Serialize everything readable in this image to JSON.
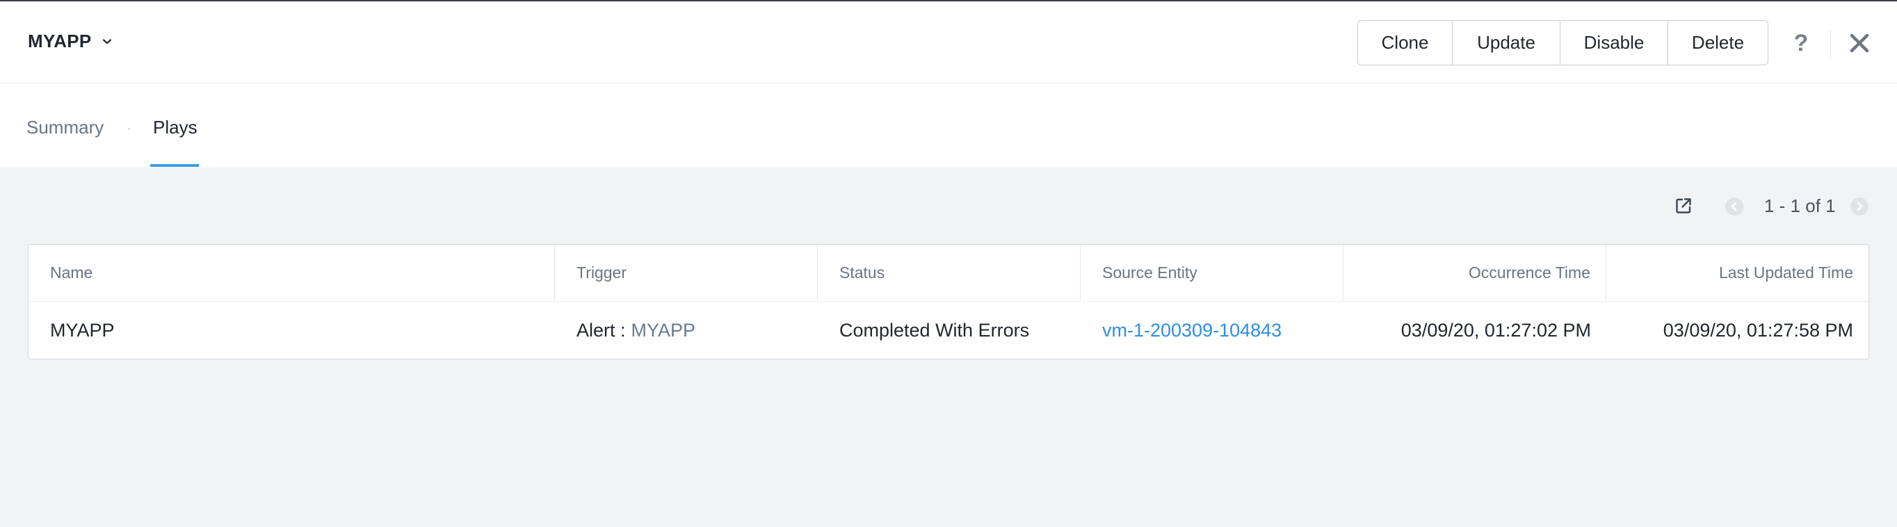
{
  "header": {
    "app_name": "MYAPP",
    "buttons": {
      "clone": "Clone",
      "update": "Update",
      "disable": "Disable",
      "delete": "Delete"
    },
    "help": "?"
  },
  "tabs": [
    {
      "label": "Summary",
      "active": false
    },
    {
      "label": "Plays",
      "active": true
    }
  ],
  "pager": {
    "text": "1 - 1 of 1"
  },
  "table": {
    "columns": [
      "Name",
      "Trigger",
      "Status",
      "Source Entity",
      "Occurrence Time",
      "Last Updated Time"
    ],
    "rows": [
      {
        "name": "MYAPP",
        "trigger_prefix": "Alert :",
        "trigger_link": "MYAPP",
        "status": "Completed With Errors",
        "source_entity": "vm-1-200309-104843",
        "occurrence_time": "03/09/20, 01:27:02 PM",
        "last_updated_time": "03/09/20, 01:27:58 PM"
      }
    ]
  },
  "colors": {
    "accent": "#3c9ee5",
    "link": "#2f8fde",
    "background": "#f2f3f5"
  },
  "icons": [
    "chevron-down-icon",
    "help-icon",
    "close-icon",
    "external-link-icon",
    "chevron-left-icon",
    "chevron-right-icon"
  ]
}
